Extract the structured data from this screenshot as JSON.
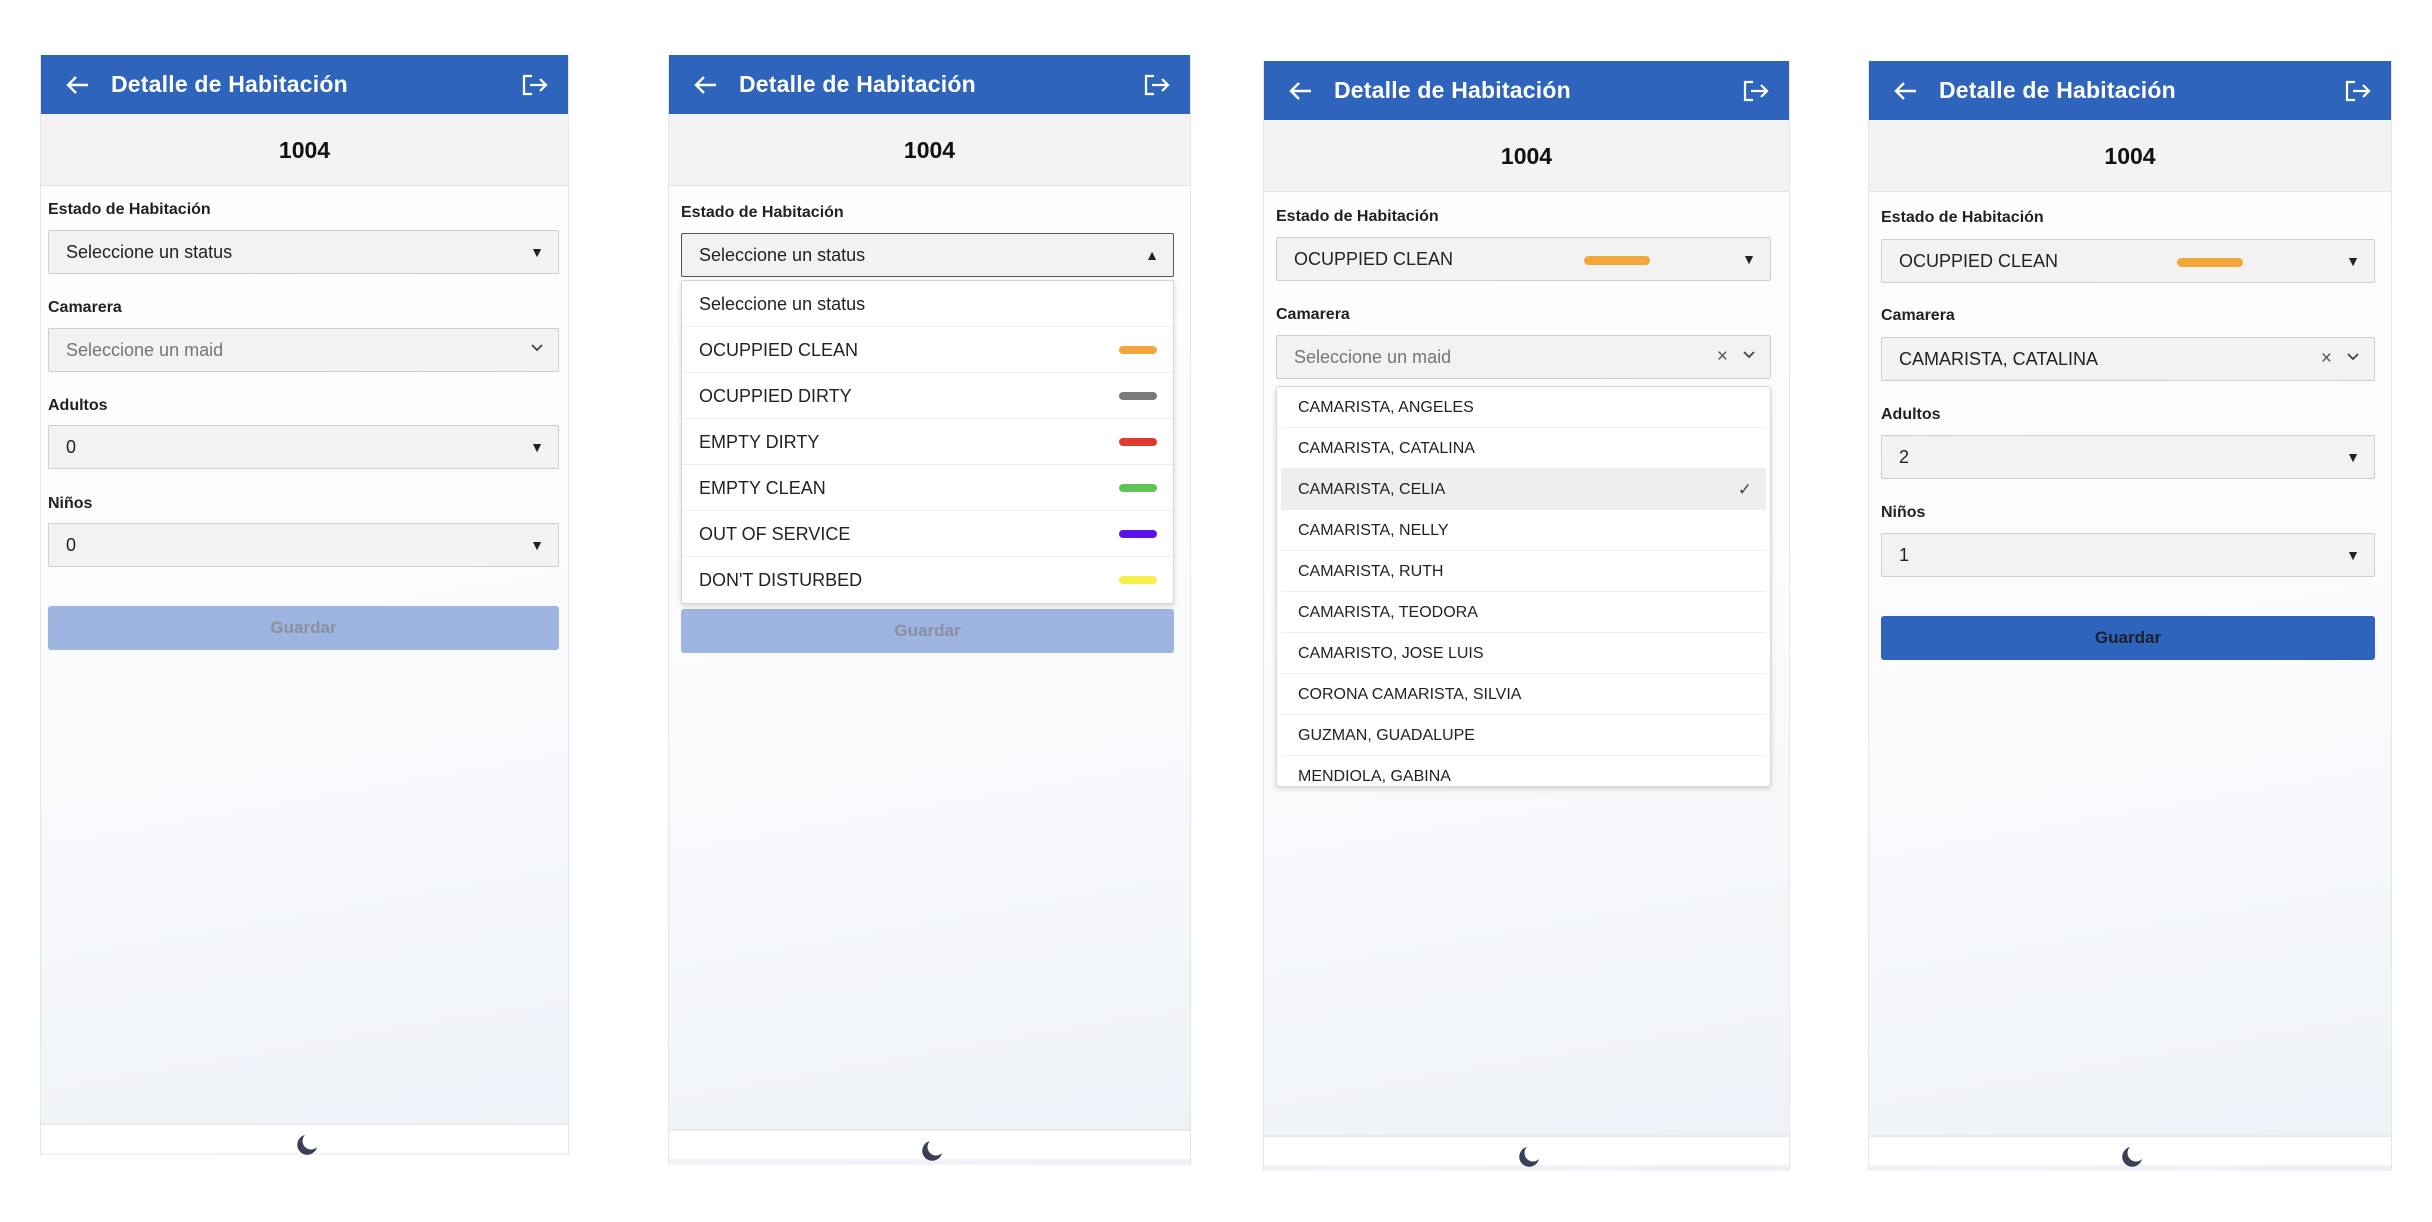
{
  "colors": {
    "brand": "#2f64bd",
    "occupied_clean": "#f3a73b",
    "occupied_dirty": "#7a7a7a",
    "empty_dirty": "#e03a31",
    "empty_clean": "#5ec453",
    "out_of_service": "#5a12e8",
    "dont_disturb": "#f5ef4a"
  },
  "header": {
    "title": "Detalle de Habitación",
    "back_icon": "arrow-left-icon",
    "logout_icon": "logout-icon"
  },
  "room": {
    "number": "1004"
  },
  "labels": {
    "estado": "Estado de Habitación",
    "camarera": "Camarera",
    "adultos": "Adultos",
    "ninos": "Niños"
  },
  "placeholders": {
    "status": "Seleccione un status",
    "maid": "Seleccione un maid"
  },
  "save_label": "Guardar",
  "screens": [
    {
      "status": "Seleccione un status",
      "maid": "Seleccione un maid",
      "adultos": "0",
      "ninos": "0",
      "save_enabled": false
    },
    {
      "status": "Seleccione un status",
      "status_dropdown_open": true,
      "save_enabled": false
    },
    {
      "status": "OCUPPIED CLEAN",
      "status_color": "#f3a73b",
      "maid": "Seleccione un maid",
      "maid_dropdown_open": true,
      "selected_maid_in_list": "CAMARISTA, CELIA"
    },
    {
      "status": "OCUPPIED CLEAN",
      "status_color": "#f3a73b",
      "maid": "CAMARISTA, CATALINA",
      "adultos": "2",
      "ninos": "1",
      "save_enabled": true
    }
  ],
  "status_options": [
    {
      "label": "Seleccione un status",
      "color": ""
    },
    {
      "label": "OCUPPIED CLEAN",
      "color": "#f3a73b"
    },
    {
      "label": "OCUPPIED DIRTY",
      "color": "#7a7a7a"
    },
    {
      "label": "EMPTY DIRTY",
      "color": "#e03a31"
    },
    {
      "label": "EMPTY CLEAN",
      "color": "#5ec453"
    },
    {
      "label": "OUT OF SERVICE",
      "color": "#5a12e8"
    },
    {
      "label": "DON'T DISTURBED",
      "color": "#f5ef4a"
    }
  ],
  "maid_options": [
    "CAMARISTA, ANGELES",
    "CAMARISTA, CATALINA",
    "CAMARISTA, CELIA",
    "CAMARISTA, NELLY",
    "CAMARISTA, RUTH",
    "CAMARISTA, TEODORA",
    "CAMARISTO, JOSE LUIS",
    "CORONA CAMARISTA, SILVIA",
    "GUZMAN, GUADALUPE",
    "MENDIOLA, GABINA"
  ],
  "footer": {
    "theme_icon": "moon-icon"
  }
}
